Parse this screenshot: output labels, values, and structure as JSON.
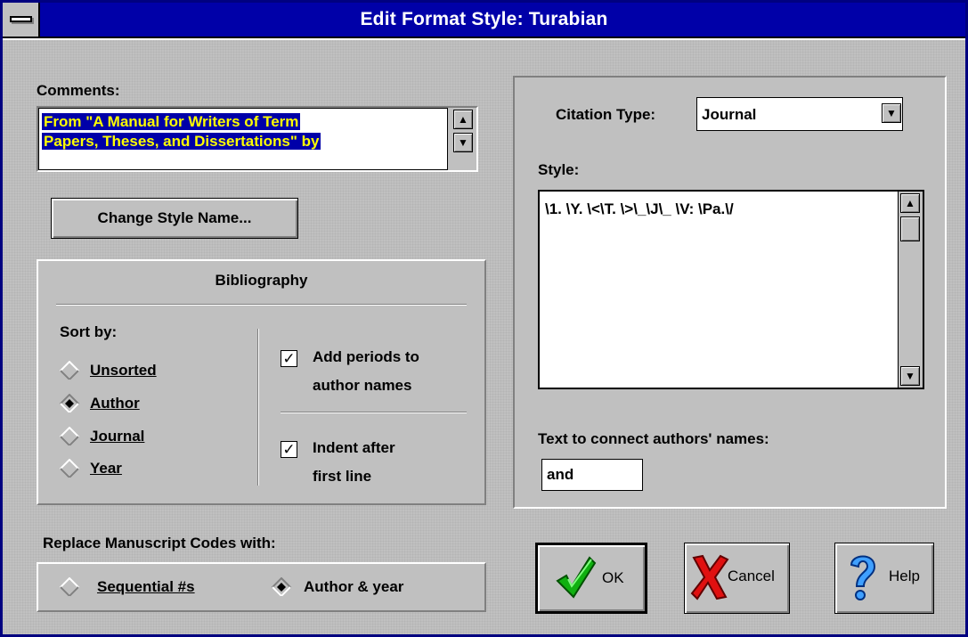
{
  "window": {
    "title": "Edit Format Style: Turabian"
  },
  "comments": {
    "label": "Comments:",
    "line1": "From \"A Manual for Writers of Term",
    "line2": "Papers, Theses, and Dissertations\" by"
  },
  "change_style_button": {
    "label": "Change Style Name..."
  },
  "bibliography": {
    "title": "Bibliography",
    "sort_label": "Sort by:",
    "sort_options": [
      {
        "label": "Unsorted",
        "selected": false
      },
      {
        "label": "Author",
        "selected": true
      },
      {
        "label": "Journal",
        "selected": false
      },
      {
        "label": "Year",
        "selected": false
      }
    ],
    "add_periods": {
      "line1": "Add periods to",
      "line2": "author names",
      "checked": true
    },
    "indent": {
      "line1": "Indent after",
      "line2": "first line",
      "checked": true
    }
  },
  "replace": {
    "label": "Replace Manuscript Codes with:",
    "options": [
      {
        "label": "Sequential #s",
        "selected": false
      },
      {
        "label": "Author & year",
        "selected": true
      }
    ]
  },
  "citation": {
    "label": "Citation Type:",
    "value": "Journal",
    "style_label": "Style:",
    "style_value": "\\1. \\Y. \\<\\T. \\>\\_\\J\\_ \\V: \\Pa.\\/",
    "connect_label": "Text to connect authors' names:",
    "connect_value": "and"
  },
  "buttons": {
    "ok": "OK",
    "cancel": "Cancel",
    "help": "Help"
  },
  "icons": {
    "ok": "green-checkmark-icon",
    "cancel": "red-x-icon",
    "help": "blue-question-mark-icon"
  },
  "colors": {
    "title_bar": "#0000a8",
    "selection_bg": "#0000a8",
    "selection_text": "#ffff00",
    "face": "#c0c0c0"
  }
}
